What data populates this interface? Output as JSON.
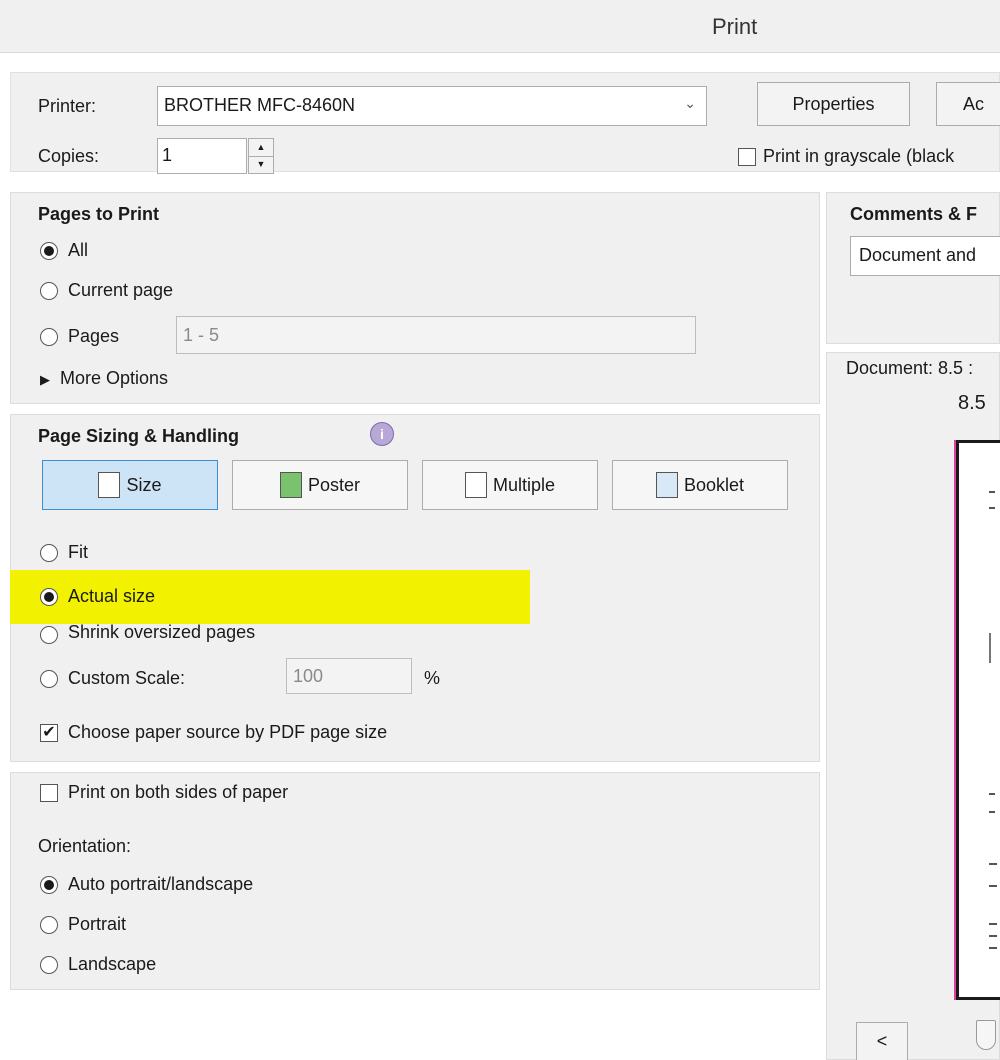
{
  "window": {
    "title": "Print"
  },
  "printer": {
    "label": "Printer:",
    "selected": "BROTHER MFC-8460N",
    "properties_label": "Properties",
    "advanced_label_partial": "Ac",
    "copies_label": "Copies:",
    "copies_value": "1",
    "grayscale_label": "Print in grayscale (black",
    "grayscale_checked": false
  },
  "pages_to_print": {
    "title": "Pages to Print",
    "options": [
      {
        "label": "All",
        "selected": true
      },
      {
        "label": "Current page",
        "selected": false
      },
      {
        "label": "Pages",
        "selected": false
      }
    ],
    "pages_range": "1 - 5",
    "more_options_label": "More Options"
  },
  "sizing": {
    "title": "Page Sizing & Handling",
    "modes": [
      {
        "label": "Size",
        "icon": "size-icon",
        "selected": true
      },
      {
        "label": "Poster",
        "icon": "poster-icon",
        "selected": false
      },
      {
        "label": "Multiple",
        "icon": "multiple-icon",
        "selected": false
      },
      {
        "label": "Booklet",
        "icon": "booklet-icon",
        "selected": false
      }
    ],
    "options": [
      {
        "label": "Fit",
        "selected": false
      },
      {
        "label": "Actual size",
        "selected": true
      },
      {
        "label": "Shrink oversized pages",
        "selected": false
      },
      {
        "label": "Custom Scale:",
        "selected": false
      }
    ],
    "custom_scale_value": "100",
    "percent_label": "%",
    "paper_source_label": "Choose paper source by PDF page size",
    "paper_source_checked": true,
    "highlight_color": "#f2f200"
  },
  "duplex": {
    "both_sides_label": "Print on both sides of paper",
    "both_sides_checked": false,
    "orientation_label": "Orientation:",
    "orientation_options": [
      {
        "label": "Auto portrait/landscape",
        "selected": true
      },
      {
        "label": "Portrait",
        "selected": false
      },
      {
        "label": "Landscape",
        "selected": false
      }
    ]
  },
  "comments_forms": {
    "title": "Comments & F",
    "selected": "Document and"
  },
  "preview": {
    "document_label": "Document: 8.5 :",
    "width_label": "8.5",
    "prev_label": "<"
  }
}
